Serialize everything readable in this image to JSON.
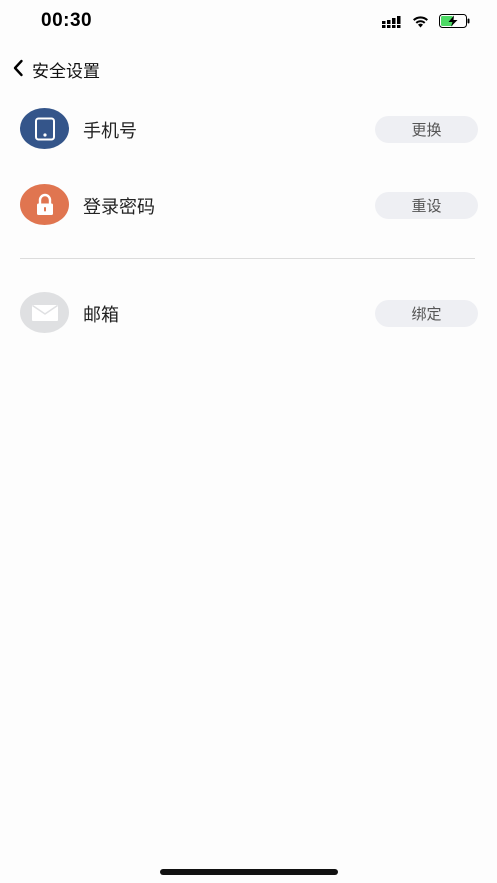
{
  "status_bar": {
    "time": "00:30"
  },
  "nav": {
    "title": "安全设置"
  },
  "rows": [
    {
      "label": "手机号",
      "button": "更换",
      "icon": "tablet-icon",
      "icon_bg": "#34558a"
    },
    {
      "label": "登录密码",
      "button": "重设",
      "icon": "lock-icon",
      "icon_bg": "#e07550"
    },
    {
      "label": "邮箱",
      "button": "绑定",
      "icon": "mail-icon",
      "icon_bg": "#dfe0e2"
    }
  ],
  "colors": {
    "background": "#fdfdfd",
    "button_bg": "#eeeff3",
    "battery_green": "#4cd964"
  }
}
